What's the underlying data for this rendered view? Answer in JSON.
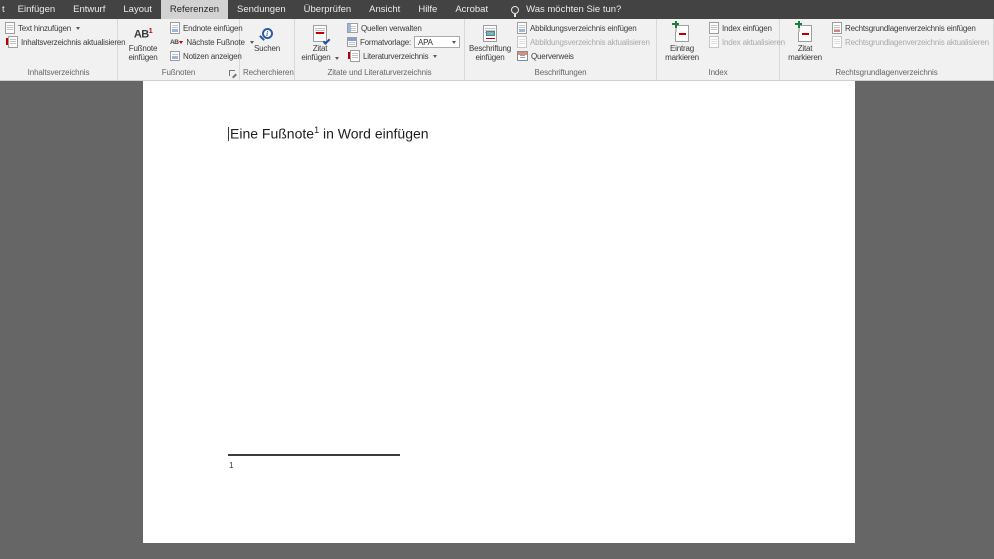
{
  "tabbar": {
    "partial_tab": "t",
    "tabs": [
      "Einfügen",
      "Entwurf",
      "Layout",
      "Referenzen",
      "Sendungen",
      "Überprüfen",
      "Ansicht",
      "Hilfe",
      "Acrobat"
    ],
    "active_tab": "Referenzen",
    "tell_me": "Was möchten Sie tun?"
  },
  "ribbon": {
    "groups": {
      "toc": {
        "label": "Inhaltsverzeichnis",
        "add_text": "Text hinzufügen",
        "update_toc": "Inhaltsverzeichnis aktualisieren"
      },
      "footnotes": {
        "label": "Fußnoten",
        "insert_footnote_icon_text": "AB",
        "insert_footnote_icon_sup": "1",
        "insert_footnote_line1": "Fußnote",
        "insert_footnote_line2": "einfügen",
        "insert_endnote": "Endnote einfügen",
        "next_footnote": "Nächste Fußnote",
        "next_footnote_icon_text": "AB",
        "show_notes": "Notizen anzeigen"
      },
      "research": {
        "label": "Recherchieren",
        "search": "Suchen",
        "search_icon_letter": "i"
      },
      "citations": {
        "label": "Zitate und Literaturverzeichnis",
        "insert_citation_line1": "Zitat",
        "insert_citation_line2": "einfügen",
        "manage_sources": "Quellen verwalten",
        "style_label": "Formatvorlage:",
        "style_value": "APA",
        "bibliography": "Literaturverzeichnis"
      },
      "captions": {
        "label": "Beschriftungen",
        "insert_caption_line1": "Beschriftung",
        "insert_caption_line2": "einfügen",
        "insert_table_of_figures": "Abbildungsverzeichnis einfügen",
        "update_table_of_figures": "Abbildungsverzeichnis aktualisieren",
        "cross_reference": "Querverweis"
      },
      "index": {
        "label": "Index",
        "mark_entry_line1": "Eintrag",
        "mark_entry_line2": "markieren",
        "insert_index": "Index einfügen",
        "update_index": "Index aktualisieren"
      },
      "authorities": {
        "label": "Rechtsgrundlagenverzeichnis",
        "mark_citation_line1": "Zitat",
        "mark_citation_line2": "markieren",
        "insert_toa": "Rechtsgrundlagenverzeichnis einfügen",
        "update_toa": "Rechtsgrundlagenverzeichnis aktualisieren"
      }
    }
  },
  "document": {
    "heading_before_ref": "Eine Fußnote",
    "footnote_reference": "1",
    "heading_after_ref": " in Word einfügen",
    "footnote_number": "1"
  },
  "colors": {
    "tabbar_bg": "#434343",
    "active_tab_bg": "#d2d2d2",
    "ribbon_bg": "#f1f1f1",
    "doc_bg": "#666666",
    "accent_red": "#c00000",
    "accent_blue": "#2b579a",
    "accent_green": "#188038"
  }
}
